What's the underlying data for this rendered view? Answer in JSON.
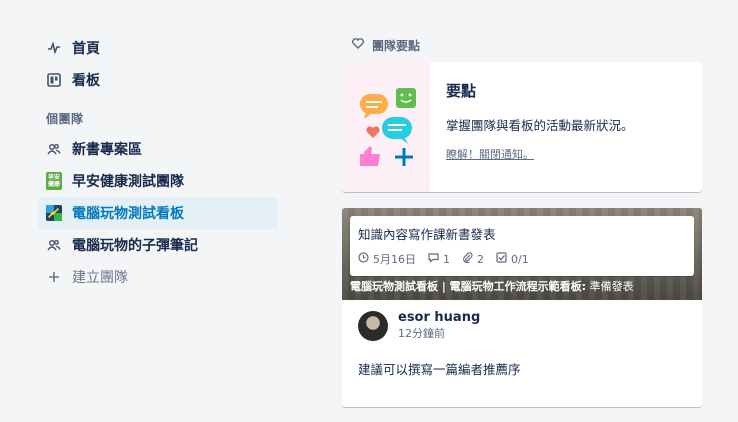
{
  "sidebar": {
    "home_label": "首頁",
    "boards_label": "看板",
    "teams_title": "個團隊",
    "teams": [
      {
        "label": "新書專案區",
        "icon": "people-icon"
      },
      {
        "label": "早安健康測試團隊",
        "icon": "team-logo",
        "logo_text": "早安健康",
        "logo_color": "#5aac44"
      },
      {
        "label": "電腦玩物測試看板",
        "icon": "team-logo",
        "logo_color": "#1f6fbf",
        "active": true
      },
      {
        "label": "電腦玩物的子彈筆記",
        "icon": "people-icon"
      }
    ],
    "create_team_label": "建立團隊"
  },
  "main": {
    "heading": "團隊要點",
    "highlights": {
      "title": "要點",
      "description": "掌握團隊與看板的活動最新狀況。",
      "link": "瞭解！關閉通知。"
    },
    "activity": {
      "card_title": "知識內容寫作課新書發表",
      "due_date": "5月16日",
      "comments": "1",
      "attachments": "2",
      "checklist": "0/1",
      "board_path_bold": "電腦玩物測試看板 | 電腦玩物工作流程示範看板:",
      "list_name": "準備發表",
      "author": "esor huang",
      "time": "12分鐘前",
      "comment": "建議可以撰寫一篇編者推薦序"
    }
  },
  "colors": {
    "active_bg": "#e4f0f6",
    "active_text": "#0079bf",
    "highlight_art_bg": "#fdf0f7"
  }
}
